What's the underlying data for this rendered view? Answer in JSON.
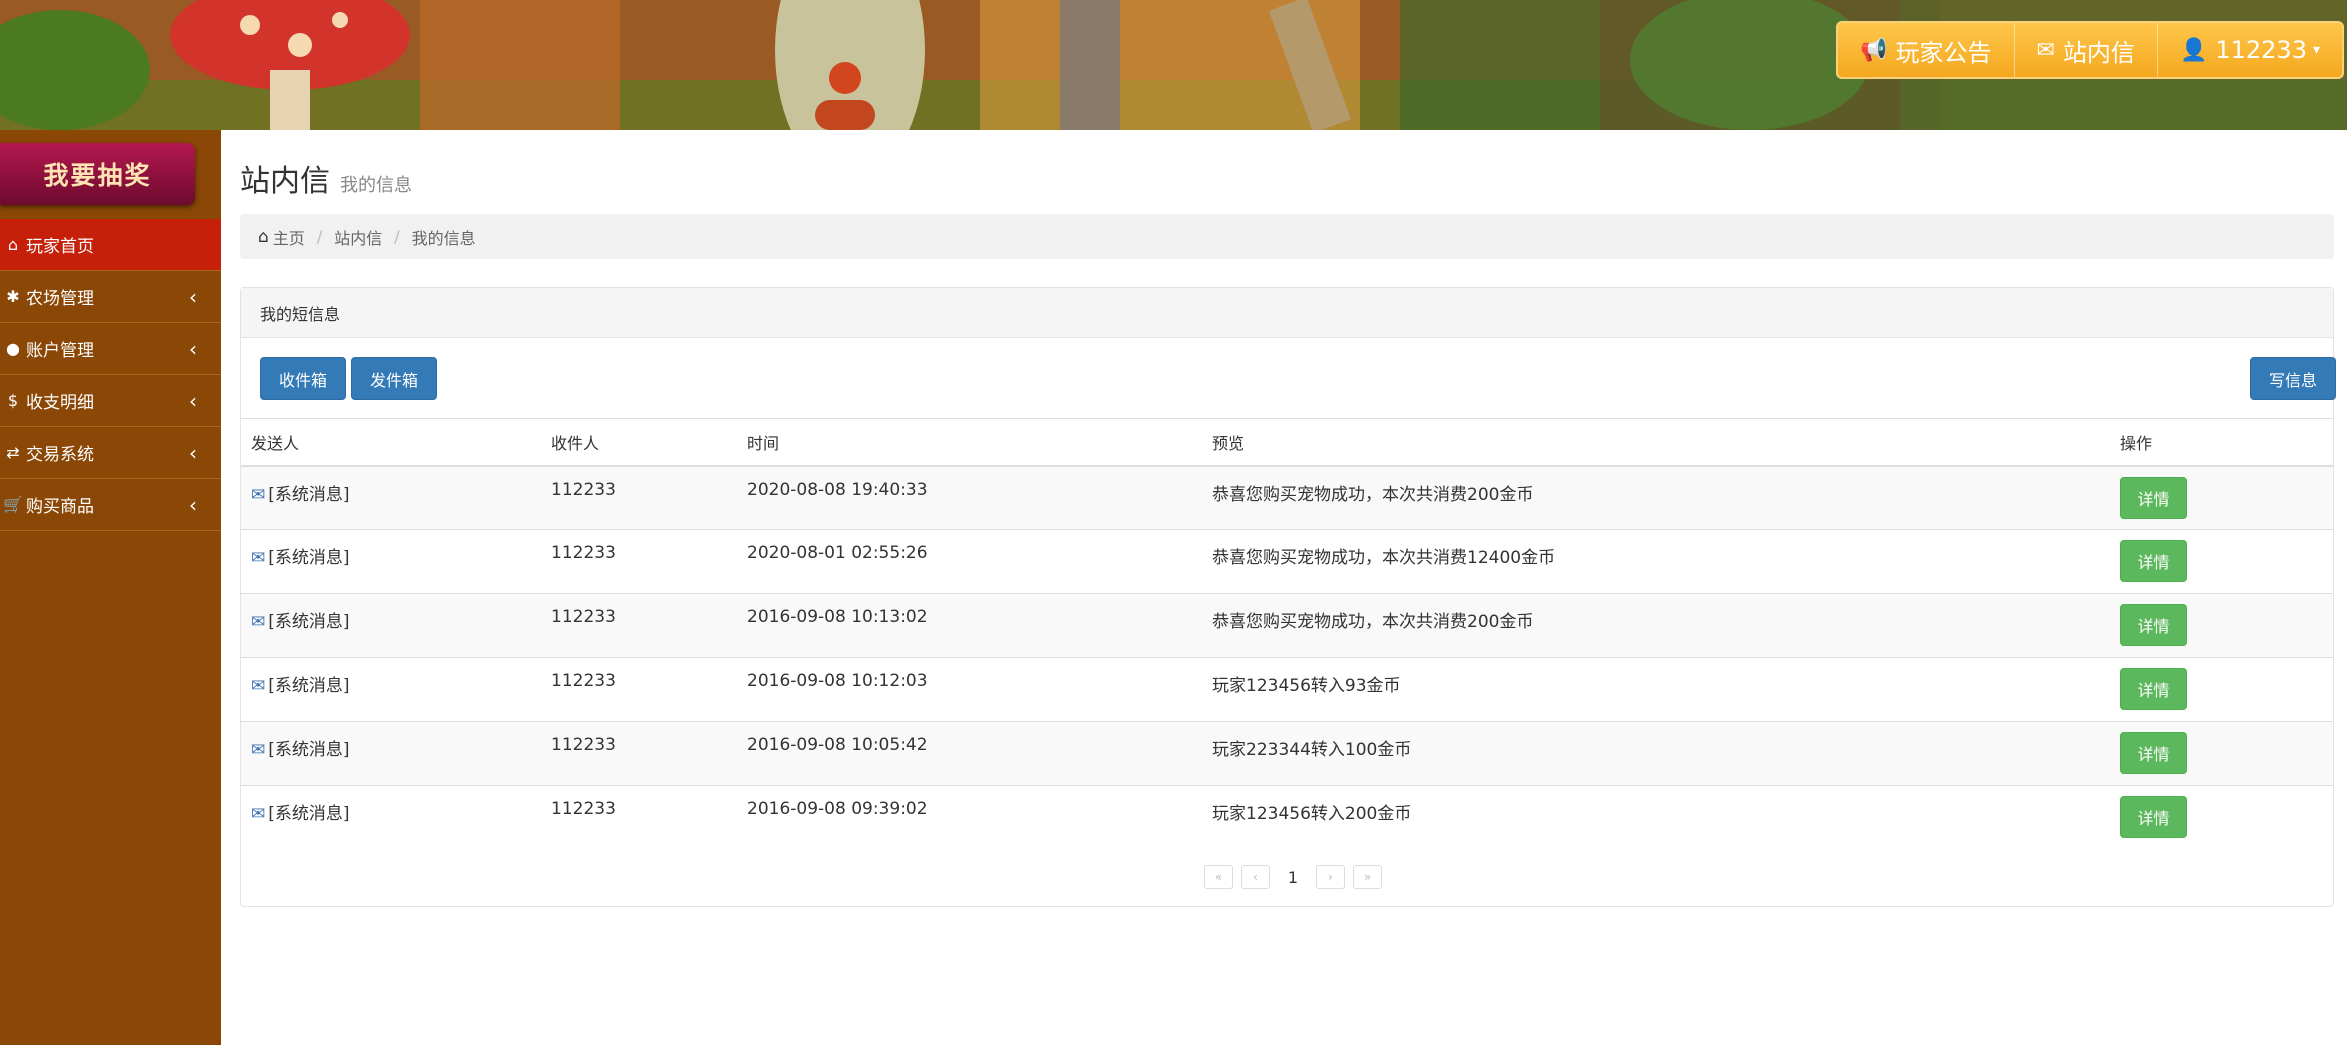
{
  "header": {
    "nav": [
      {
        "icon": "megaphone-icon",
        "label": "玩家公告"
      },
      {
        "icon": "envelope-icon",
        "label": "站内信"
      },
      {
        "icon": "user-icon",
        "label": "112233"
      }
    ]
  },
  "sidebar": {
    "lottery_label": "我要抽奖",
    "items": [
      {
        "icon": "home-icon",
        "label": "玩家首页",
        "active": true
      },
      {
        "icon": "farm-icon",
        "label": "农场管理"
      },
      {
        "icon": "user-icon",
        "label": "账户管理"
      },
      {
        "icon": "dollar-icon",
        "label": "收支明细"
      },
      {
        "icon": "exchange-icon",
        "label": "交易系统"
      },
      {
        "icon": "cart-icon",
        "label": "购买商品"
      }
    ]
  },
  "page": {
    "title": "站内信",
    "subtitle": "我的信息"
  },
  "breadcrumb": [
    "主页",
    "站内信",
    "我的信息"
  ],
  "panel": {
    "heading": "我的短信息",
    "inbox_label": "收件箱",
    "outbox_label": "发件箱",
    "compose_label": "写信息"
  },
  "table": {
    "columns": [
      "发送人",
      "收件人",
      "时间",
      "预览",
      "操作"
    ],
    "detail_label": "详情",
    "rows": [
      {
        "sender": "[系统消息]",
        "recipient": "112233",
        "time": "2020-08-08 19:40:33",
        "preview": "恭喜您购买宠物成功，本次共消费200金币"
      },
      {
        "sender": "[系统消息]",
        "recipient": "112233",
        "time": "2020-08-01 02:55:26",
        "preview": "恭喜您购买宠物成功，本次共消费12400金币"
      },
      {
        "sender": "[系统消息]",
        "recipient": "112233",
        "time": "2016-09-08 10:13:02",
        "preview": "恭喜您购买宠物成功，本次共消费200金币"
      },
      {
        "sender": "[系统消息]",
        "recipient": "112233",
        "time": "2016-09-08 10:12:03",
        "preview": "玩家123456转入93金币"
      },
      {
        "sender": "[系统消息]",
        "recipient": "112233",
        "time": "2016-09-08 10:05:42",
        "preview": "玩家223344转入100金币"
      },
      {
        "sender": "[系统消息]",
        "recipient": "112233",
        "time": "2016-09-08 09:39:02",
        "preview": "玩家123456转入200金币"
      }
    ]
  },
  "pagination": {
    "first": "«",
    "prev": "‹",
    "current": "1",
    "next": "›",
    "last": "»"
  }
}
